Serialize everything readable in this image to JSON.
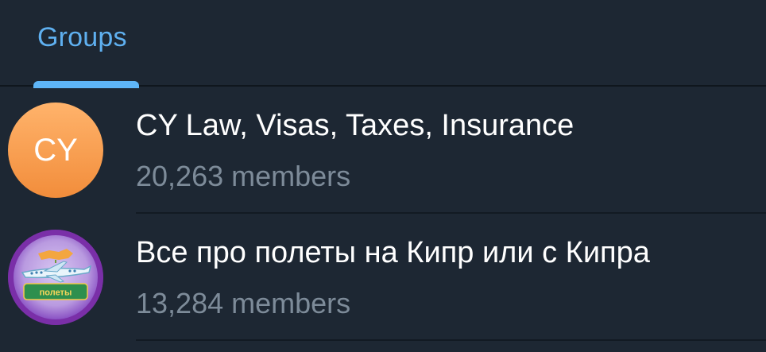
{
  "tabs": [
    {
      "label": "Groups",
      "active": true
    }
  ],
  "groups": [
    {
      "avatar_initials": "CY",
      "name": "CY Law, Visas, Taxes, Insurance",
      "members": "20,263 members"
    },
    {
      "avatar_text": "полеты",
      "name": "Все про полеты на Кипр или с Кипра",
      "members": "13,284 members"
    }
  ],
  "colors": {
    "background": "#1d2733",
    "accent": "#5eb5f7",
    "title_text": "#ffffff",
    "secondary_text": "#7d8b99",
    "avatar_cy": "#f5993f",
    "avatar_flights": "#7a2fa8"
  }
}
